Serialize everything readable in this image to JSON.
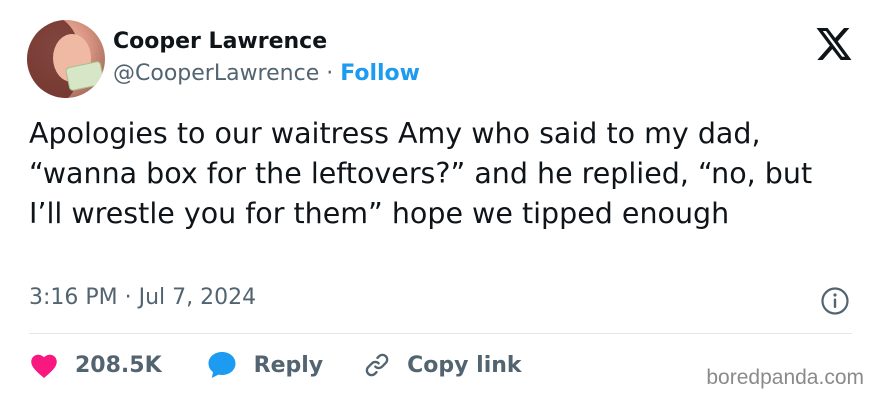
{
  "tweet": {
    "author_name": "Cooper Lawrence",
    "author_handle": "@CooperLawrence",
    "separator": " · ",
    "follow_label": "Follow",
    "text": "Apologies to our waitress Amy who said to my dad, “wanna box for the leftovers?” and he replied, “no, but I’ll wrestle you for them” hope we tipped enough",
    "timestamp": "3:16 PM · Jul 7, 2024",
    "logo_icon": "x-logo-icon",
    "info_icon": "info-icon"
  },
  "actions": {
    "like_count": "208.5K",
    "reply_label": "Reply",
    "copy_link_label": "Copy link",
    "like_icon": "heart-icon",
    "reply_icon": "speech-bubble-icon",
    "copy_icon": "link-icon"
  },
  "colors": {
    "follow": "#1d9bf0",
    "heart": "#f91880",
    "reply_bubble": "#1d9bf0",
    "text": "#0f1419",
    "muted": "#536471"
  },
  "watermark": "boredpanda.com"
}
